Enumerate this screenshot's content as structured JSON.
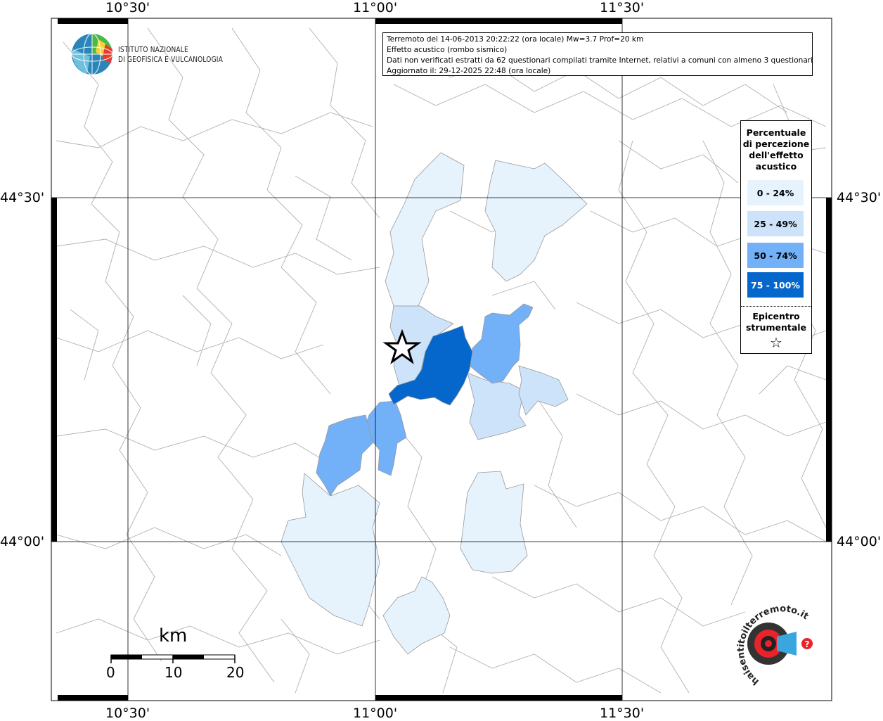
{
  "coordinates": {
    "lon_labels": [
      "10°30'",
      "11°00'",
      "11°30'"
    ],
    "lat_labels": [
      "44°30'",
      "44°00'"
    ]
  },
  "logo": {
    "line1": "ISTITUTO NAZIONALE",
    "line2": "DI GEOFISICA E VULCANOLOGIA"
  },
  "info": {
    "line1": "Terremoto del 14-06-2013 20:22:22 (ora locale) Mw=3.7 Prof=20 km",
    "line2": "Effetto acustico (rombo sismico)",
    "line3": "Dati non verificati estratti da 62 questionari compilati tramite Internet, relativi a comuni con almeno 3 questionari.",
    "line4": "Aggiornato il: 29-12-2025 22:48 (ora locale)"
  },
  "legend": {
    "title": "Percentuale di percezione dell'effetto acustico",
    "classes": [
      {
        "label": "0 - 24%",
        "color": "#e6f3fd"
      },
      {
        "label": "25 - 49%",
        "color": "#cce3fa"
      },
      {
        "label": "50 - 74%",
        "color": "#72b0f8"
      },
      {
        "label": "75 - 100%",
        "color": "#0566cc"
      }
    ],
    "epicenter_label": "Epicentro strumentale",
    "epicenter_symbol": "☆"
  },
  "scale": {
    "unit": "km",
    "ticks": [
      "0",
      "10",
      "20"
    ]
  },
  "watermark": {
    "text": "haisentitoilterremoto.it"
  },
  "colors": {
    "grid": "#000000",
    "boundary": "#b0b0b0"
  }
}
